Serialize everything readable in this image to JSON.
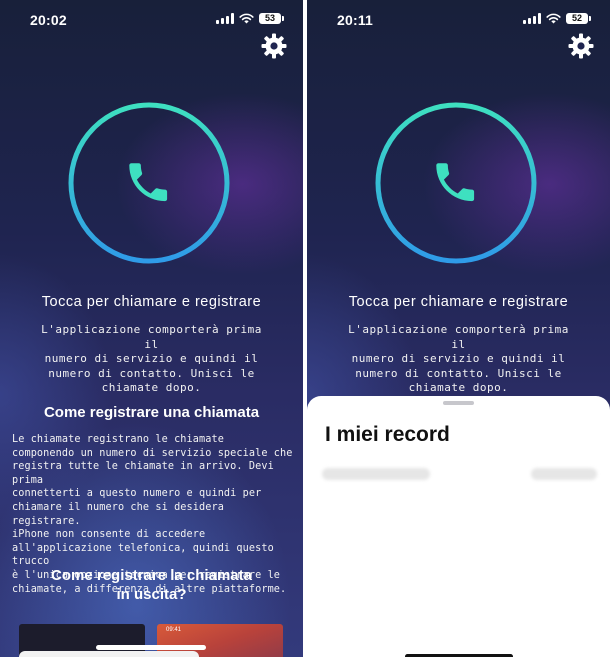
{
  "left_screen": {
    "status": {
      "time": "20:02",
      "battery": "53"
    },
    "call": {
      "title": "Tocca per chiamare e registrare",
      "description": "L'applicazione comporterà prima il\nnumero di servizio e quindi il\nnumero di contatto. Unisci le\nchiamate dopo."
    },
    "howto": {
      "heading": "Come registrare una chiamata",
      "body": "Le chiamate registrano le chiamate\ncomponendo un numero di servizio speciale che\nregistra tutte le chiamate in arrivo. Devi prima\nconnetterti a questo numero e quindi per\nchiamare il numero che si desidera registrare.\niPhone non consente di accedere\nall'applicazione telefonica, quindi questo trucco\nè l'unica opzione tecnica per registrare le\nchiamate, a differenza di altre piattaforme."
    },
    "outgoing_heading": "Come registrare la chiamata\nin uscita?",
    "thumb_time": "09:41"
  },
  "right_screen": {
    "status": {
      "time": "20:11",
      "battery": "52"
    },
    "call": {
      "title": "Tocca per chiamare e registrare",
      "description": "L'applicazione comporterà prima il\nnumero di servizio e quindi il\nnumero di contatto. Unisci le\nchiamate dopo."
    },
    "sheet": {
      "title": "I miei record"
    }
  },
  "colors": {
    "accent_start": "#3ee0c0",
    "accent_end": "#2f9be8",
    "sheet_bg": "#ffffff"
  },
  "icons": {
    "settings": "gear-icon",
    "call": "phone-icon",
    "signal": "cellular-signal-icon",
    "wifi": "wifi-icon",
    "battery": "battery-icon"
  }
}
